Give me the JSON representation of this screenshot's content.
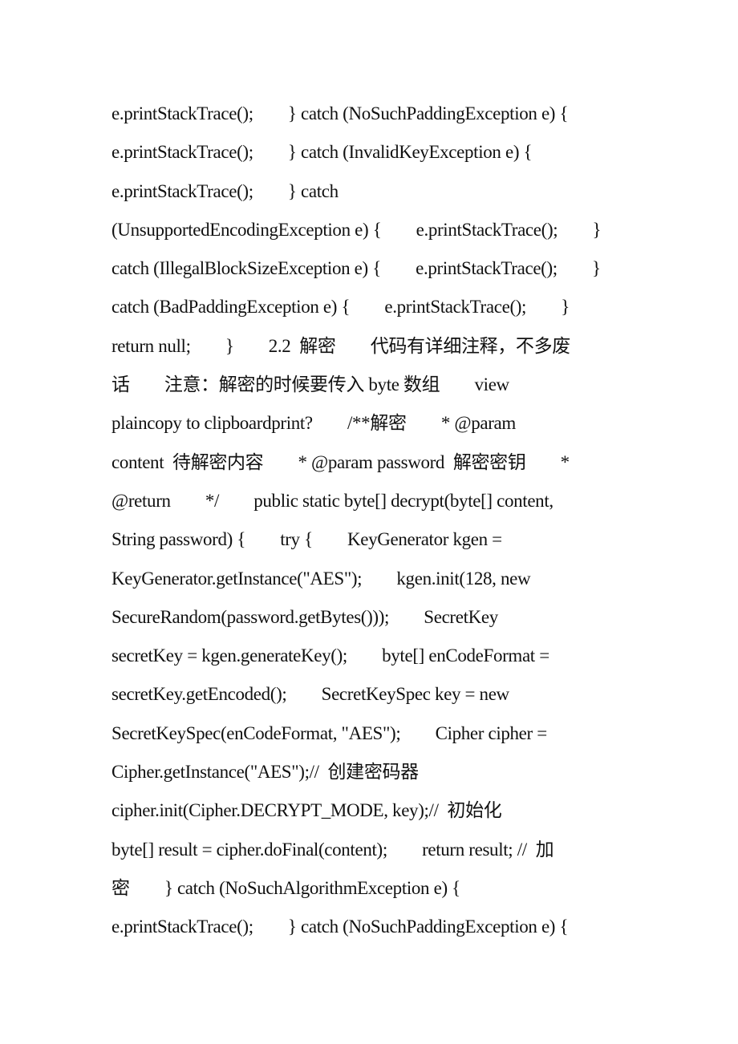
{
  "document": {
    "lines": [
      "e.printStackTrace();        } catch (NoSuchPaddingException e) {",
      "e.printStackTrace();        } catch (InvalidKeyException e) {",
      "e.printStackTrace();        } catch",
      "(UnsupportedEncodingException e) {        e.printStackTrace();        }",
      "catch (IllegalBlockSizeException e) {        e.printStackTrace();        }",
      "catch (BadPaddingException e) {        e.printStackTrace();        }",
      "return null;        }        2.2  解密        代码有详细注释，不多废",
      "话        注意：解密的时候要传入 byte 数组        view",
      "plaincopy to clipboardprint?        /**解密        * @param",
      "content  待解密内容        * @param password  解密密钥        *",
      "@return        */        public static byte[] decrypt(byte[] content,",
      "String password) {        try {        KeyGenerator kgen =",
      "KeyGenerator.getInstance(\"AES\");        kgen.init(128, new",
      "SecureRandom(password.getBytes()));        SecretKey",
      "secretKey = kgen.generateKey();        byte[] enCodeFormat =",
      "secretKey.getEncoded();        SecretKeySpec key = new",
      "SecretKeySpec(enCodeFormat, \"AES\");        Cipher cipher =",
      "Cipher.getInstance(\"AES\");//  创建密码器",
      "cipher.init(Cipher.DECRYPT_MODE, key);//  初始化",
      "byte[] result = cipher.doFinal(content);        return result; //  加",
      "密        } catch (NoSuchAlgorithmException e) {",
      "e.printStackTrace();        } catch (NoSuchPaddingException e) {"
    ]
  }
}
